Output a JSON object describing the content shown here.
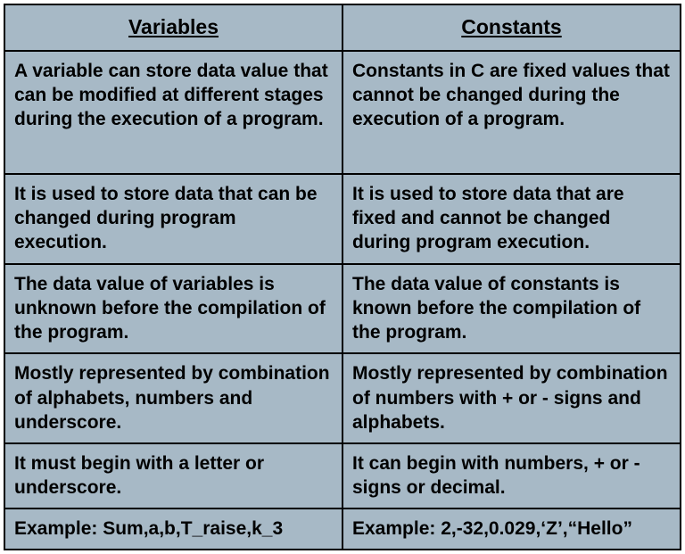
{
  "chart_data": {
    "type": "table",
    "columns": [
      "Variables",
      "Constants"
    ],
    "rows": [
      [
        "A variable can store data value that can be modified at different stages during the execution of a program.",
        "Constants in C are fixed values that cannot be changed during the execution of a program."
      ],
      [
        "It is used to store data that can be changed during program execution.",
        "It is used to store data that are fixed and cannot be changed during program execution."
      ],
      [
        "The data value of variables is unknown before the compilation of the program.",
        "The data value of constants is known before the compilation of the program."
      ],
      [
        "Mostly represented by combination of alphabets, numbers and underscore.",
        "Mostly represented by combination of numbers with + or - signs and alphabets."
      ],
      [
        "It must begin with a letter or underscore.",
        "It can begin with numbers, + or - signs or decimal."
      ],
      [
        "Example: Sum,a,b,T_raise,k_3",
        "Example: 2,-32,0.029,‘Z’,“Hello”"
      ]
    ]
  },
  "headers": {
    "col0": "Variables",
    "col1": "Constants"
  },
  "rows": {
    "r0c0": "A variable can store data value that can be modified at different stages during the execution of a program.",
    "r0c1": "Constants in C are fixed values that cannot be changed during the execution of a program.",
    "r1c0": "It is used to store data that can be changed during program execution.",
    "r1c1": "It is used to store data that are fixed and cannot be changed during program execution.",
    "r2c0": "The data value of variables is unknown before the compilation of the program.",
    "r2c1": "The data value of constants is known before the compilation of the program.",
    "r3c0": "Mostly represented by combination of alphabets, numbers and underscore.",
    "r3c1": "Mostly represented by combination of numbers with + or - signs and alphabets.",
    "r4c0": "It must begin with a letter or underscore.",
    "r4c1": "It can begin with numbers, + or - signs or decimal.",
    "r5c0": "Example: Sum,a,b,T_raise,k_3",
    "r5c1": "Example: 2,-32,0.029,‘Z’,“Hello”"
  }
}
